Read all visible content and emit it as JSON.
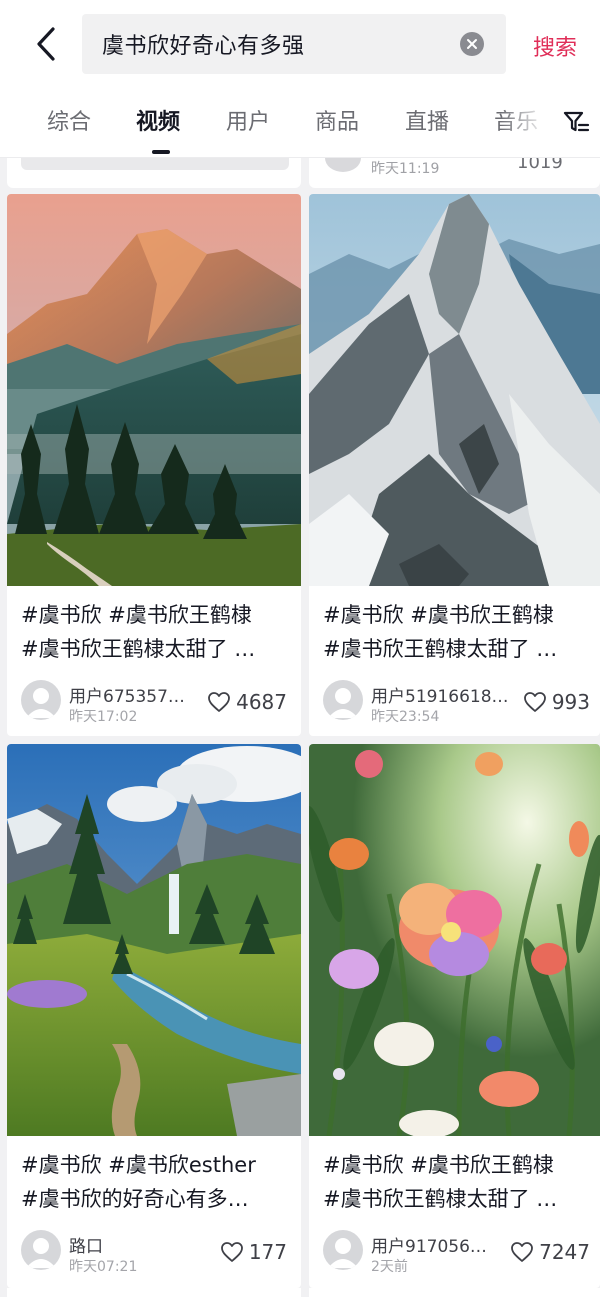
{
  "search": {
    "query": "虞书欣好奇心有多强",
    "submit_label": "搜索"
  },
  "tabs": [
    {
      "label": "综合",
      "active": false
    },
    {
      "label": "视频",
      "active": true
    },
    {
      "label": "用户",
      "active": false
    },
    {
      "label": "商品",
      "active": false
    },
    {
      "label": "直播",
      "active": false
    },
    {
      "label": "音乐",
      "active": false
    }
  ],
  "previous_row": {
    "right_time": "昨天11:19",
    "right_likes": "1019"
  },
  "results": [
    {
      "title_line1": "#虞书欣 #虞书欣王鹤棣",
      "title_line2": "#虞书欣王鹤棣太甜了 …",
      "author": "用户675357…",
      "time": "昨天17:02",
      "likes": "4687",
      "cover": "sunset-mountain-forest"
    },
    {
      "title_line1": "#虞书欣 #虞书欣王鹤棣",
      "title_line2": "#虞书欣王鹤棣太甜了 …",
      "author": "用户51916618…",
      "time": "昨天23:54",
      "likes": "993",
      "cover": "snowy-mountain-peak"
    },
    {
      "title_line1": "#虞书欣 #虞书欣esther",
      "title_line2": "#虞书欣的好奇心有多…",
      "author": "路口",
      "time": "昨天07:21",
      "likes": "177",
      "cover": "alpine-valley-stream"
    },
    {
      "title_line1": "#虞书欣 #虞书欣王鹤棣",
      "title_line2": "#虞书欣王鹤棣太甜了 …",
      "author": "用户917056…",
      "time": "2天前",
      "likes": "7247",
      "cover": "colorful-flower-field"
    }
  ],
  "colors": {
    "accent": "#e02e58",
    "text": "#161823",
    "muted": "#a4a5aa",
    "background": "#f1f1f3"
  },
  "icons": [
    "back-arrow-icon",
    "clear-icon",
    "filter-icon",
    "heart-icon",
    "avatar-placeholder-icon"
  ]
}
